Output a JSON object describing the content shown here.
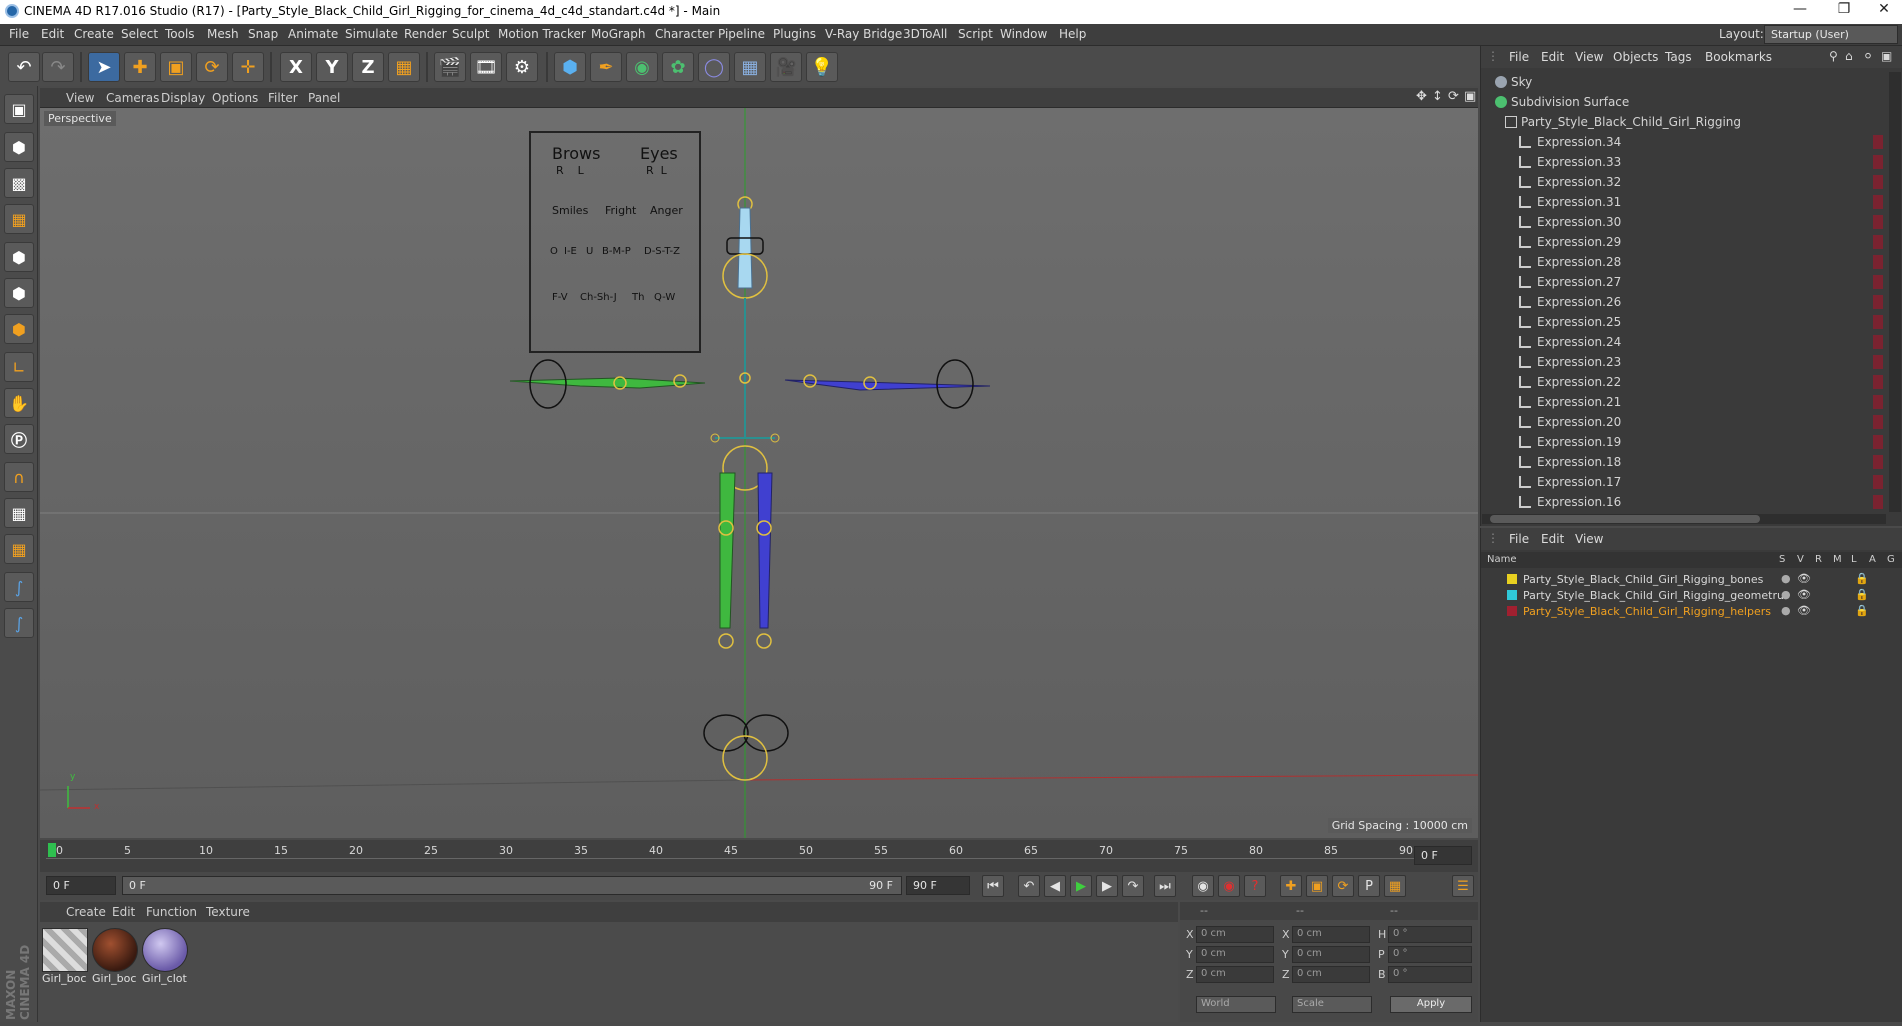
{
  "window": {
    "title": "CINEMA 4D R17.016 Studio (R17) - [Party_Style_Black_Child_Girl_Rigging_for_cinema_4d_c4d_standart.c4d *] - Main",
    "minimize_icon": "minimize-icon",
    "maximize_icon": "restore-icon",
    "close_icon": "close-icon"
  },
  "menubar": [
    "File",
    "Edit",
    "Create",
    "Select",
    "Tools",
    "Mesh",
    "Snap",
    "Animate",
    "Simulate",
    "Render",
    "Sculpt",
    "Motion Tracker",
    "MoGraph",
    "Character",
    "Pipeline",
    "Plugins",
    "V-Ray Bridge",
    "3DToAll",
    "Script",
    "Window",
    "Help"
  ],
  "layout": {
    "label": "Layout:",
    "value": "Startup (User)"
  },
  "toolbar_icons": [
    "undo-icon",
    "redo-icon",
    "select-icon",
    "move-icon",
    "scale-icon",
    "rotate-icon",
    "move-axis-icon",
    "x-axis-icon",
    "y-axis-icon",
    "z-axis-icon",
    "coordinate-system-icon",
    "render-view-icon",
    "render-picture-viewer-icon",
    "render-settings-icon",
    "cube-icon",
    "pen-spline-icon",
    "subdivision-icon",
    "cloner-icon",
    "deformer-icon",
    "floor-icon",
    "camera-icon",
    "light-icon"
  ],
  "toolbar_glyphs": {
    "x": "X",
    "y": "Y",
    "z": "Z"
  },
  "left_tools": [
    "make-editable-icon",
    "model-mode-icon",
    "texture-mode-icon",
    "workplane-icon",
    "points-mode-icon",
    "edges-mode-icon",
    "polygons-mode-icon",
    "axis-icon",
    "tweak-icon",
    "snap-icon",
    "magnet-icon",
    "lock-workplane-icon",
    "planar-workplane-icon",
    "python-icon",
    "python-icon-2"
  ],
  "viewport": {
    "menu": [
      "View",
      "Cameras",
      "Display",
      "Options",
      "Filter",
      "Panel"
    ],
    "label": "Perspective",
    "grid_spacing": "Grid Spacing : 10000 cm",
    "control_board": {
      "heading1": "Brows",
      "heading2": "Eyes",
      "rl1": "R    L",
      "rl2": "R  L",
      "row2": [
        "Smiles",
        "Fright",
        "Anger"
      ],
      "row3": [
        "O",
        "I-E",
        "U",
        "B-M-P",
        "D-S-T-Z"
      ],
      "row4": [
        "F-V",
        "Ch-Sh-J",
        "Th",
        "Q-W"
      ]
    },
    "axis": {
      "y": "y",
      "x": "x"
    }
  },
  "timeline": {
    "ticks": [
      "0",
      "5",
      "10",
      "15",
      "20",
      "25",
      "30",
      "35",
      "40",
      "45",
      "50",
      "55",
      "60",
      "65",
      "70",
      "75",
      "80",
      "85",
      "90"
    ],
    "end_field": "0 F"
  },
  "playbar": {
    "start": "0 F",
    "range_start": "0 F",
    "range_end": "90 F",
    "end": "90 F"
  },
  "materials": {
    "menu": [
      "Create",
      "Edit",
      "Function",
      "Texture"
    ],
    "items": [
      {
        "label": "Girl_boc",
        "color": "#c8c8c8"
      },
      {
        "label": "Girl_boc",
        "color": "#5a2a1a"
      },
      {
        "label": "Girl_clot",
        "color": "#9a8ad0"
      }
    ],
    "brand": "MAXON CINEMA 4D"
  },
  "coordinates": {
    "header": [
      "--",
      "--",
      "--"
    ],
    "rows": [
      {
        "l1": "X",
        "v1": "0 cm",
        "l2": "X",
        "v2": "0 cm",
        "l3": "H",
        "v3": "0 °"
      },
      {
        "l1": "Y",
        "v1": "0 cm",
        "l2": "Y",
        "v2": "0 cm",
        "l3": "P",
        "v3": "0 °"
      },
      {
        "l1": "Z",
        "v1": "0 cm",
        "l2": "Z",
        "v2": "0 cm",
        "l3": "B",
        "v3": "0 °"
      }
    ],
    "mode": "World",
    "size_mode": "Scale",
    "apply": "Apply"
  },
  "object_manager": {
    "menu": [
      "File",
      "Edit",
      "View",
      "Objects",
      "Tags",
      "Bookmarks"
    ],
    "rows": [
      {
        "name": "Sky",
        "indent": 0,
        "icon_color": "#9aa4b0"
      },
      {
        "name": "Subdivision Surface",
        "indent": 0,
        "icon_color": "#4cc070"
      },
      {
        "name": "Party_Style_Black_Child_Girl_Rigging",
        "indent": 1,
        "icon_color": "#cfcfcf"
      },
      {
        "name": "Expression.34",
        "indent": 2,
        "icon_color": "#cfcfcf"
      },
      {
        "name": "Expression.33",
        "indent": 2,
        "icon_color": "#cfcfcf"
      },
      {
        "name": "Expression.32",
        "indent": 2,
        "icon_color": "#cfcfcf"
      },
      {
        "name": "Expression.31",
        "indent": 2,
        "icon_color": "#cfcfcf"
      },
      {
        "name": "Expression.30",
        "indent": 2,
        "icon_color": "#cfcfcf"
      },
      {
        "name": "Expression.29",
        "indent": 2,
        "icon_color": "#cfcfcf"
      },
      {
        "name": "Expression.28",
        "indent": 2,
        "icon_color": "#cfcfcf"
      },
      {
        "name": "Expression.27",
        "indent": 2,
        "icon_color": "#cfcfcf"
      },
      {
        "name": "Expression.26",
        "indent": 2,
        "icon_color": "#cfcfcf"
      },
      {
        "name": "Expression.25",
        "indent": 2,
        "icon_color": "#cfcfcf"
      },
      {
        "name": "Expression.24",
        "indent": 2,
        "icon_color": "#cfcfcf"
      },
      {
        "name": "Expression.23",
        "indent": 2,
        "icon_color": "#cfcfcf"
      },
      {
        "name": "Expression.22",
        "indent": 2,
        "icon_color": "#cfcfcf"
      },
      {
        "name": "Expression.21",
        "indent": 2,
        "icon_color": "#cfcfcf"
      },
      {
        "name": "Expression.20",
        "indent": 2,
        "icon_color": "#cfcfcf"
      },
      {
        "name": "Expression.19",
        "indent": 2,
        "icon_color": "#cfcfcf"
      },
      {
        "name": "Expression.18",
        "indent": 2,
        "icon_color": "#cfcfcf"
      },
      {
        "name": "Expression.17",
        "indent": 2,
        "icon_color": "#cfcfcf"
      },
      {
        "name": "Expression.16",
        "indent": 2,
        "icon_color": "#cfcfcf"
      }
    ]
  },
  "layer_manager": {
    "menu": [
      "File",
      "Edit",
      "View"
    ],
    "columns": [
      "Name",
      "S",
      "V",
      "R",
      "M",
      "L",
      "A",
      "G"
    ],
    "rows": [
      {
        "name": "Party_Style_Black_Child_Girl_Rigging_bones",
        "color": "#e8d020",
        "highlight": false
      },
      {
        "name": "Party_Style_Black_Child_Girl_Rigging_geometru",
        "color": "#30c8d8",
        "highlight": false
      },
      {
        "name": "Party_Style_Black_Child_Girl_Rigging_helpers",
        "color": "#a02030",
        "highlight": true
      }
    ]
  },
  "colors": {
    "accent": "#3c6aa0",
    "highlight_text": "#f0a020",
    "timeline_marker": "#2fbf4f"
  }
}
